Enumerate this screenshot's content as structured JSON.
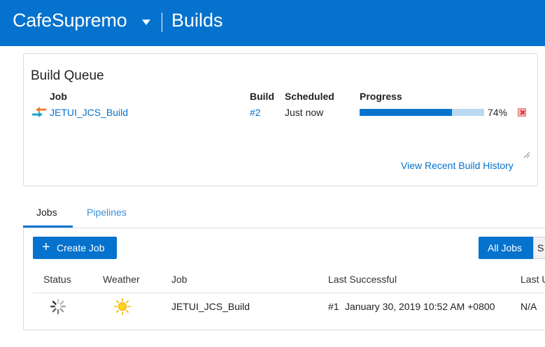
{
  "header": {
    "app_name": "CafeSupremo",
    "section": "Builds"
  },
  "build_queue": {
    "title": "Build Queue",
    "columns": {
      "job": "Job",
      "build": "Build",
      "scheduled": "Scheduled",
      "progress": "Progress"
    },
    "item": {
      "job": "JETUI_JCS_Build",
      "build": "#2",
      "scheduled": "Just now",
      "progress_percent": 74,
      "progress_label": "74%"
    },
    "history_link": "View Recent Build History"
  },
  "tabs": [
    {
      "label": "Jobs",
      "active": true
    },
    {
      "label": "Pipelines",
      "active": false
    }
  ],
  "toolbar": {
    "create_job_label": "Create Job",
    "all_jobs_label": "All Jobs",
    "other_filter_label": "S"
  },
  "jobs_table": {
    "headers": [
      "Status",
      "Weather",
      "Job",
      "Last Successful",
      "Last U"
    ],
    "rows": [
      {
        "status": "building-spinner-icon",
        "weather": "sunny-icon",
        "job": "JETUI_JCS_Build",
        "last_successful_build": "#1",
        "last_successful_date": "January 30, 2019 10:52 AM +0800",
        "last_unsuccessful": "N/A"
      }
    ]
  },
  "colors": {
    "brand_blue": "#0572ce",
    "progress_track": "#b9d9f0",
    "cancel_red": "#dd3333"
  }
}
